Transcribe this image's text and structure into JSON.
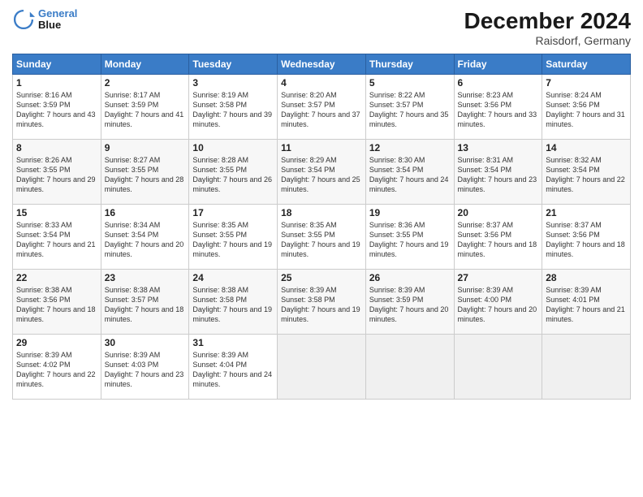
{
  "logo": {
    "line1": "General",
    "line2": "Blue"
  },
  "title": "December 2024",
  "subtitle": "Raisdorf, Germany",
  "days_header": [
    "Sunday",
    "Monday",
    "Tuesday",
    "Wednesday",
    "Thursday",
    "Friday",
    "Saturday"
  ],
  "weeks": [
    [
      {
        "day": "1",
        "sunrise": "8:16 AM",
        "sunset": "3:59 PM",
        "daylight": "7 hours and 43 minutes."
      },
      {
        "day": "2",
        "sunrise": "8:17 AM",
        "sunset": "3:59 PM",
        "daylight": "7 hours and 41 minutes."
      },
      {
        "day": "3",
        "sunrise": "8:19 AM",
        "sunset": "3:58 PM",
        "daylight": "7 hours and 39 minutes."
      },
      {
        "day": "4",
        "sunrise": "8:20 AM",
        "sunset": "3:57 PM",
        "daylight": "7 hours and 37 minutes."
      },
      {
        "day": "5",
        "sunrise": "8:22 AM",
        "sunset": "3:57 PM",
        "daylight": "7 hours and 35 minutes."
      },
      {
        "day": "6",
        "sunrise": "8:23 AM",
        "sunset": "3:56 PM",
        "daylight": "7 hours and 33 minutes."
      },
      {
        "day": "7",
        "sunrise": "8:24 AM",
        "sunset": "3:56 PM",
        "daylight": "7 hours and 31 minutes."
      }
    ],
    [
      {
        "day": "8",
        "sunrise": "8:26 AM",
        "sunset": "3:55 PM",
        "daylight": "7 hours and 29 minutes."
      },
      {
        "day": "9",
        "sunrise": "8:27 AM",
        "sunset": "3:55 PM",
        "daylight": "7 hours and 28 minutes."
      },
      {
        "day": "10",
        "sunrise": "8:28 AM",
        "sunset": "3:55 PM",
        "daylight": "7 hours and 26 minutes."
      },
      {
        "day": "11",
        "sunrise": "8:29 AM",
        "sunset": "3:54 PM",
        "daylight": "7 hours and 25 minutes."
      },
      {
        "day": "12",
        "sunrise": "8:30 AM",
        "sunset": "3:54 PM",
        "daylight": "7 hours and 24 minutes."
      },
      {
        "day": "13",
        "sunrise": "8:31 AM",
        "sunset": "3:54 PM",
        "daylight": "7 hours and 23 minutes."
      },
      {
        "day": "14",
        "sunrise": "8:32 AM",
        "sunset": "3:54 PM",
        "daylight": "7 hours and 22 minutes."
      }
    ],
    [
      {
        "day": "15",
        "sunrise": "8:33 AM",
        "sunset": "3:54 PM",
        "daylight": "7 hours and 21 minutes."
      },
      {
        "day": "16",
        "sunrise": "8:34 AM",
        "sunset": "3:54 PM",
        "daylight": "7 hours and 20 minutes."
      },
      {
        "day": "17",
        "sunrise": "8:35 AM",
        "sunset": "3:55 PM",
        "daylight": "7 hours and 19 minutes."
      },
      {
        "day": "18",
        "sunrise": "8:35 AM",
        "sunset": "3:55 PM",
        "daylight": "7 hours and 19 minutes."
      },
      {
        "day": "19",
        "sunrise": "8:36 AM",
        "sunset": "3:55 PM",
        "daylight": "7 hours and 19 minutes."
      },
      {
        "day": "20",
        "sunrise": "8:37 AM",
        "sunset": "3:56 PM",
        "daylight": "7 hours and 18 minutes."
      },
      {
        "day": "21",
        "sunrise": "8:37 AM",
        "sunset": "3:56 PM",
        "daylight": "7 hours and 18 minutes."
      }
    ],
    [
      {
        "day": "22",
        "sunrise": "8:38 AM",
        "sunset": "3:56 PM",
        "daylight": "7 hours and 18 minutes."
      },
      {
        "day": "23",
        "sunrise": "8:38 AM",
        "sunset": "3:57 PM",
        "daylight": "7 hours and 18 minutes."
      },
      {
        "day": "24",
        "sunrise": "8:38 AM",
        "sunset": "3:58 PM",
        "daylight": "7 hours and 19 minutes."
      },
      {
        "day": "25",
        "sunrise": "8:39 AM",
        "sunset": "3:58 PM",
        "daylight": "7 hours and 19 minutes."
      },
      {
        "day": "26",
        "sunrise": "8:39 AM",
        "sunset": "3:59 PM",
        "daylight": "7 hours and 20 minutes."
      },
      {
        "day": "27",
        "sunrise": "8:39 AM",
        "sunset": "4:00 PM",
        "daylight": "7 hours and 20 minutes."
      },
      {
        "day": "28",
        "sunrise": "8:39 AM",
        "sunset": "4:01 PM",
        "daylight": "7 hours and 21 minutes."
      }
    ],
    [
      {
        "day": "29",
        "sunrise": "8:39 AM",
        "sunset": "4:02 PM",
        "daylight": "7 hours and 22 minutes."
      },
      {
        "day": "30",
        "sunrise": "8:39 AM",
        "sunset": "4:03 PM",
        "daylight": "7 hours and 23 minutes."
      },
      {
        "day": "31",
        "sunrise": "8:39 AM",
        "sunset": "4:04 PM",
        "daylight": "7 hours and 24 minutes."
      },
      null,
      null,
      null,
      null
    ]
  ]
}
